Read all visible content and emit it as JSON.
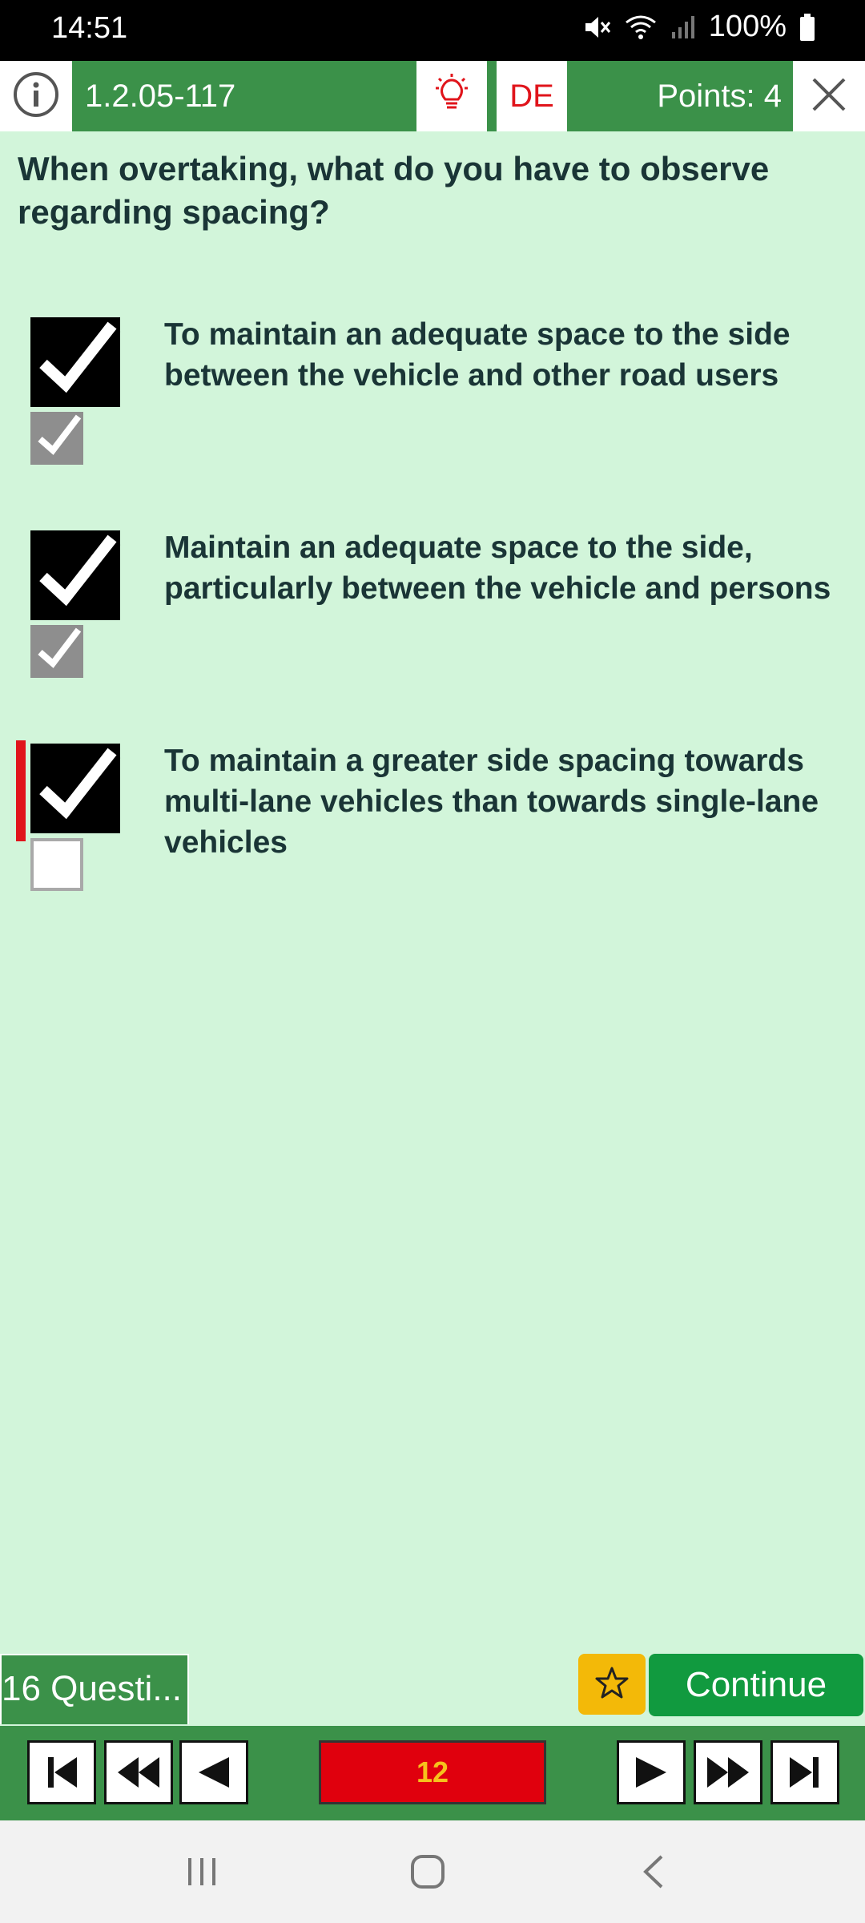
{
  "status_bar": {
    "time": "14:51",
    "battery": "100%"
  },
  "header": {
    "question_id": "1.2.05-117",
    "language": "DE",
    "points": "Points: 4"
  },
  "question": {
    "text": "When overtaking, what do you have to observe regarding spacing?"
  },
  "answers": [
    {
      "text": "To maintain an adequate space to the side between the vehicle and other road users",
      "user_checked": true,
      "solution_checked": true,
      "wrong": false
    },
    {
      "text": "Maintain an adequate space to the side, particularly between the vehicle and persons",
      "user_checked": true,
      "solution_checked": true,
      "wrong": false
    },
    {
      "text": "To maintain a greater side spacing towards multi-lane vehicles than towards single-lane vehicles",
      "user_checked": true,
      "solution_checked": false,
      "wrong": true
    }
  ],
  "footer": {
    "questions_tab": "16 Questi...",
    "continue_label": "Continue",
    "page_number": "12"
  },
  "colors": {
    "green": "#3b9149",
    "background": "#d2f5da",
    "red": "#e0141b",
    "continue": "#119a3f",
    "favorite": "#f3b908"
  },
  "icons": [
    "info-icon",
    "lightbulb-icon",
    "close-icon",
    "star-icon",
    "first-icon",
    "rewind-icon",
    "prev-icon",
    "next-icon",
    "fast-forward-icon",
    "last-icon",
    "recents-icon",
    "home-icon",
    "back-icon"
  ]
}
